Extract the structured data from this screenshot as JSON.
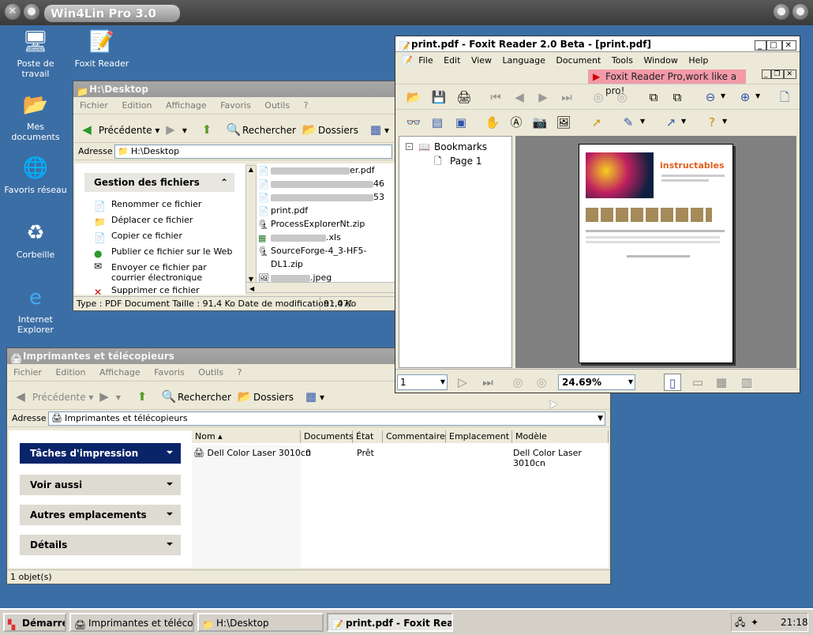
{
  "host": {
    "title": "Win4Lin Pro 3.0"
  },
  "desktop_icons": [
    {
      "label": "Poste de travail",
      "icon": "computer-icon"
    },
    {
      "label": "Foxit Reader",
      "icon": "foxit-shortcut-icon"
    },
    {
      "label": "Mes documents",
      "icon": "folder-documents-icon"
    },
    {
      "label": "Favoris réseau",
      "icon": "network-icon"
    },
    {
      "label": "Corbeille",
      "icon": "recycle-bin-icon"
    },
    {
      "label": "Internet Explorer",
      "icon": "internet-explorer-icon"
    }
  ],
  "desktop_window": {
    "title": "H:\\Desktop",
    "menu": [
      "Fichier",
      "Edition",
      "Affichage",
      "Favoris",
      "Outils",
      "?"
    ],
    "toolbar": {
      "back": "Précédente",
      "search": "Rechercher",
      "folders": "Dossiers"
    },
    "address_label": "Adresse",
    "address": "H:\\Desktop",
    "task_panel": {
      "title": "Gestion des fichiers",
      "links": [
        "Renommer ce fichier",
        "Déplacer ce fichier",
        "Copier ce fichier",
        "Publier ce fichier sur le Web",
        "Envoyer ce fichier par courrier électronique",
        "Supprimer ce fichier"
      ]
    },
    "files": [
      {
        "name": "er.pdf",
        "blurred": true
      },
      {
        "name": "46",
        "blurred": true
      },
      {
        "name": "53",
        "blurred": true
      },
      {
        "name": "print.pdf",
        "blurred": false
      },
      {
        "name": "ProcessExplorerNt.zip",
        "blurred": false
      },
      {
        "name": ".xls",
        "blurred": true
      },
      {
        "name": "SourceForge-4_3-HF5-DL1.zip",
        "blurred": false
      },
      {
        "name": ".jpeg",
        "blurred": true
      }
    ],
    "status": "Type : PDF Document Taille  : 91,4 Ko Date de modification : 07/",
    "status_size": "91,4 Ko"
  },
  "printers_window": {
    "title": "Imprimantes et télécopieurs",
    "menu": [
      "Fichier",
      "Edition",
      "Affichage",
      "Favoris",
      "Outils",
      "?"
    ],
    "toolbar": {
      "back": "Précédente",
      "search": "Rechercher",
      "folders": "Dossiers"
    },
    "address_label": "Adresse",
    "address": "Imprimantes et télécopieurs",
    "tasks": [
      "Tâches d'impression",
      "Voir aussi",
      "Autres emplacements",
      "Détails"
    ],
    "columns": [
      "Nom",
      "Documents",
      "État",
      "Commentaires",
      "Emplacement",
      "Modèle"
    ],
    "rows": [
      {
        "name": "Dell Color Laser 3010cn",
        "documents": "0",
        "state": "Prêt",
        "comments": "",
        "location": "",
        "model": "Dell Color Laser 3010cn"
      }
    ],
    "status": "1 objet(s)"
  },
  "foxit_window": {
    "title": "print.pdf - Foxit Reader 2.0 Beta - [print.pdf]",
    "menu": [
      "File",
      "Edit",
      "View",
      "Language",
      "Document",
      "Tools",
      "Window",
      "Help"
    ],
    "promo": "Foxit Reader Pro,work like a pro!",
    "bookmarks_root": "Bookmarks",
    "bookmarks": [
      "Page 1"
    ],
    "page_number": "1",
    "zoom": "24.69%",
    "page_preview": {
      "brand": "instructables"
    }
  },
  "taskbar": {
    "start": "Démarrer",
    "buttons": [
      "Imprimantes et télécopie...",
      "H:\\Desktop",
      "print.pdf - Foxit Read..."
    ],
    "clock": "21:18"
  },
  "colors": {
    "desktop": "#3b6ea5",
    "task_header_active": "#0a246a",
    "promo": "#f39aa8"
  }
}
